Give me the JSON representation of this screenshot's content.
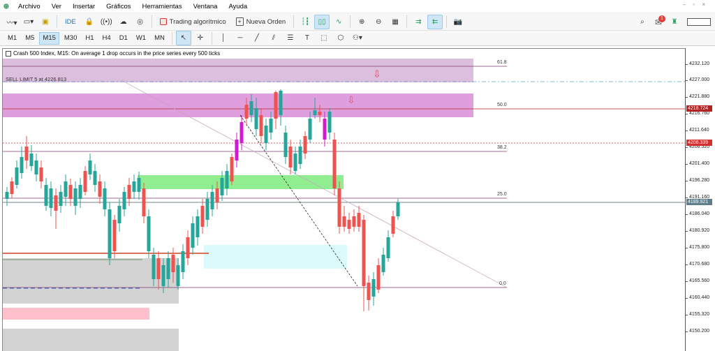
{
  "menu": {
    "items": [
      "Archivo",
      "Ver",
      "Insertar",
      "Gráficos",
      "Herramientas",
      "Ventana",
      "Ayuda"
    ]
  },
  "toolbar": {
    "ide_label": "IDE",
    "algo_label": "Trading algorítmico",
    "new_order_label": "Nueva Orden",
    "notifications_count": "1"
  },
  "timeframes": [
    "M1",
    "M5",
    "M15",
    "M30",
    "H1",
    "H4",
    "D1",
    "W1",
    "MN"
  ],
  "timeframe_selected": "M15",
  "chart": {
    "header_text": "Crash 500 Index, M15:  On average 1 drop occurs in the price series every 500 ticks",
    "order_label": "SELL LIMIT 5 at 4226.813",
    "fib_labels": {
      "f618": "61.8",
      "f50": "50.0",
      "f382": "38.2",
      "f25": "25.0",
      "f0": "0.0"
    },
    "price_labels": [
      "4232.120",
      "4227.000",
      "4221.880",
      "4216.760",
      "4211.640",
      "4206.520",
      "4201.400",
      "4196.280",
      "4191.160",
      "4186.040",
      "4180.920",
      "4175.800",
      "4170.680",
      "4165.560",
      "4160.440",
      "4155.320",
      "4150.200"
    ],
    "price_tags": {
      "red_line": "4218.724",
      "red_dotted": "4208.339",
      "current": "4189.921"
    },
    "colors": {
      "bull": "#26a69a",
      "bear": "#ef5350",
      "bull_highlight": "#d01bd0",
      "sell_zone_top": "#dcbedd",
      "sell_zone": "#df9fdf",
      "demand_zone": "#90ee90",
      "light_blue_zone": "#dcfafc",
      "gray_zone": "#d3d3d3",
      "pink_zone": "#ffc0cb",
      "level_red": "#b22222",
      "fib_line": "#7b3b6b"
    }
  }
}
